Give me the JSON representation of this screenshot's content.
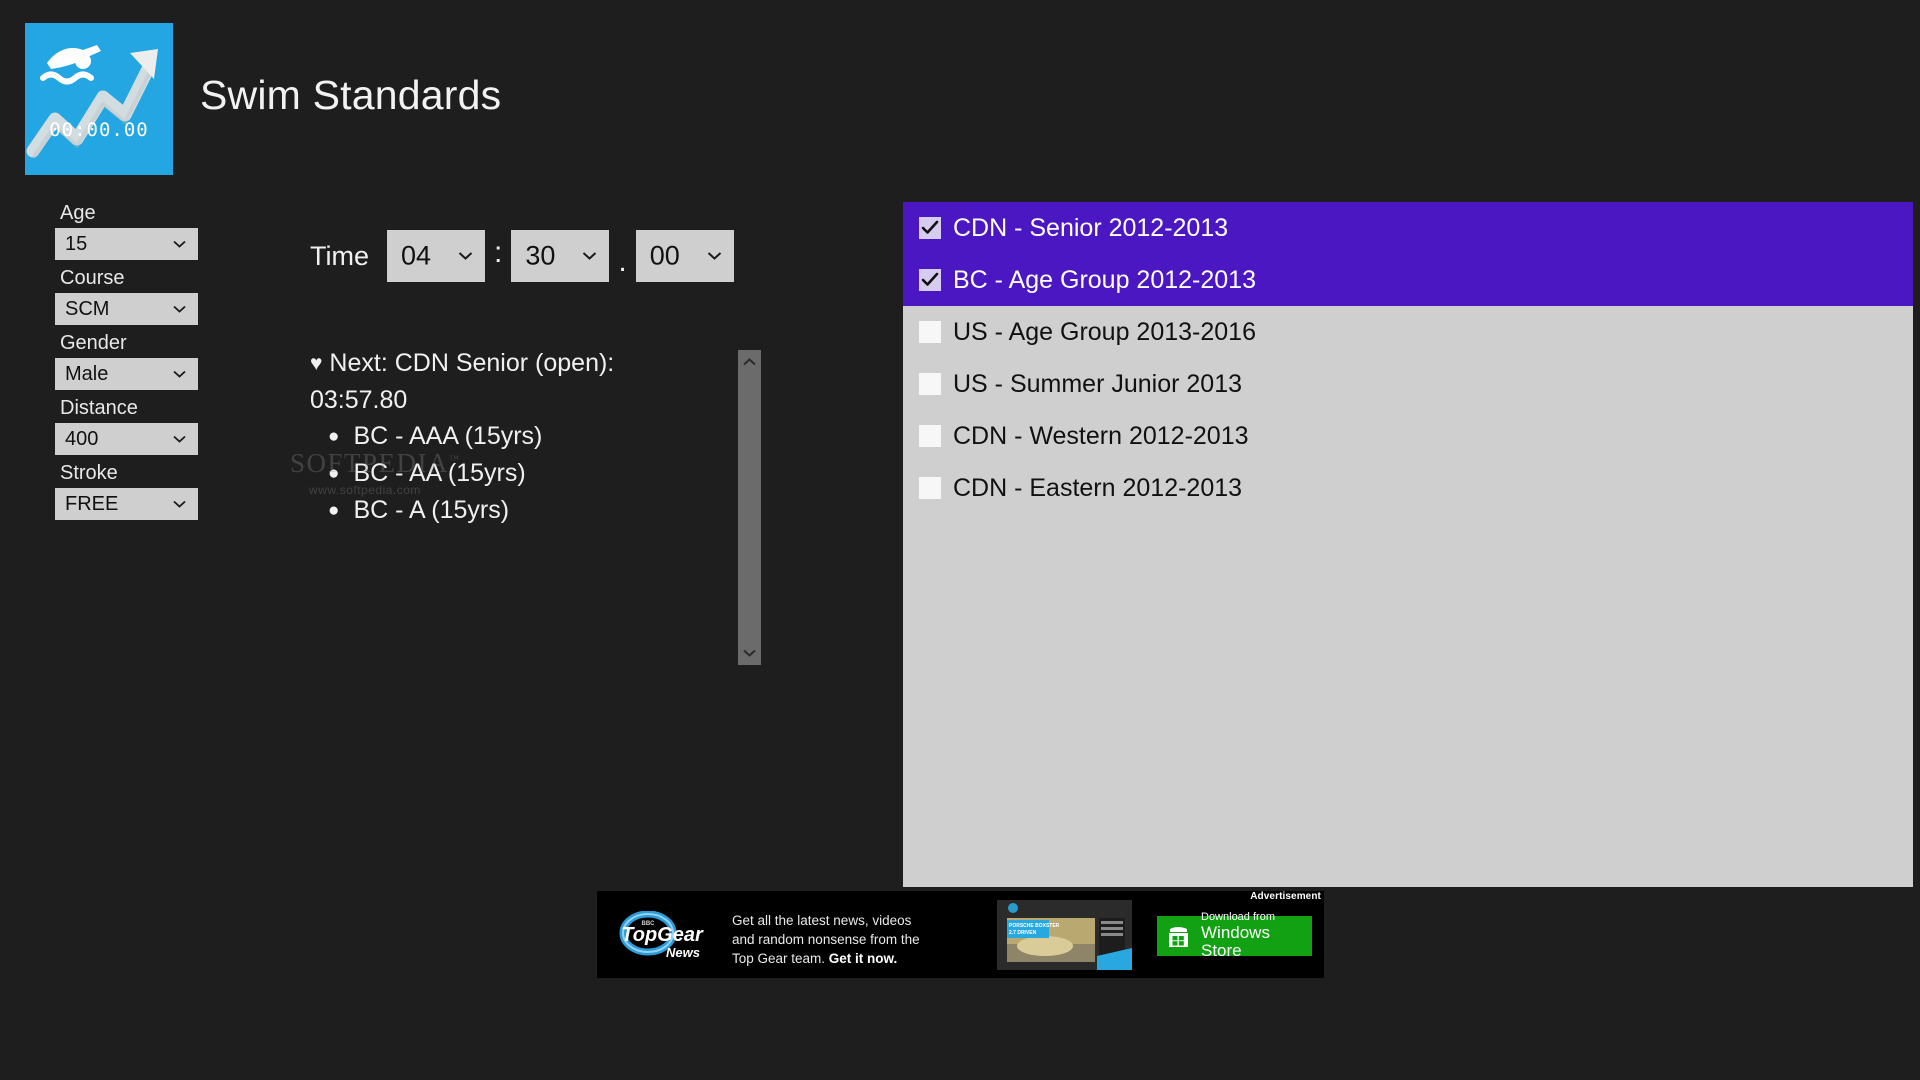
{
  "app": {
    "title": "Swim Standards",
    "logo_timer_text": "00:00.00",
    "logo_bg_color": "#23a6e2",
    "background_color": "#1e1e1e"
  },
  "controls": [
    {
      "label": "Age",
      "value": "15",
      "name": "age"
    },
    {
      "label": "Course",
      "value": "SCM",
      "name": "course"
    },
    {
      "label": "Gender",
      "value": "Male",
      "name": "gender"
    },
    {
      "label": "Distance",
      "value": "400",
      "name": "distance"
    },
    {
      "label": "Stroke",
      "value": "FREE",
      "name": "stroke"
    }
  ],
  "time": {
    "label": "Time",
    "minutes": "04",
    "seconds": "30",
    "hundredths": "00",
    "separator_colon": ":",
    "separator_dot": "."
  },
  "results": {
    "next_marker": "♥",
    "next_line": "Next: CDN Senior (open):",
    "next_time": "03:57.80",
    "bullet_marker": "●",
    "items": [
      "BC - AAA (15yrs)",
      "BC - AA (15yrs)",
      "BC - A (15yrs)"
    ]
  },
  "standards_list": {
    "selected_color": "#4b17c3",
    "panel_color": "#cfcfcf",
    "items": [
      {
        "label": "CDN - Senior 2012-2013",
        "checked": true
      },
      {
        "label": "BC - Age Group 2012-2013",
        "checked": true
      },
      {
        "label": "US - Age Group 2013-2016",
        "checked": false
      },
      {
        "label": "US - Summer Junior 2013",
        "checked": false
      },
      {
        "label": "CDN - Western 2012-2013",
        "checked": false
      },
      {
        "label": "CDN - Eastern 2012-2013",
        "checked": false
      }
    ]
  },
  "watermark": {
    "main": "SOFTPEDIA",
    "tm": "™",
    "sub": "www.softpedia.com"
  },
  "advertisement": {
    "label": "Advertisement",
    "brand_top": "TopGear",
    "brand_bottom": "News",
    "brand_micro": "BBC",
    "body_text": "Get all the latest news, videos and random nonsense from the Top Gear team. ",
    "body_cta": "Get it now.",
    "store_line1": "Download from",
    "store_line2": "Windows Store",
    "store_color": "#12a112",
    "thumb_caption_line1": "PORSCHE BOXSTER",
    "thumb_caption_line2": "2.7 DRIVEN"
  }
}
